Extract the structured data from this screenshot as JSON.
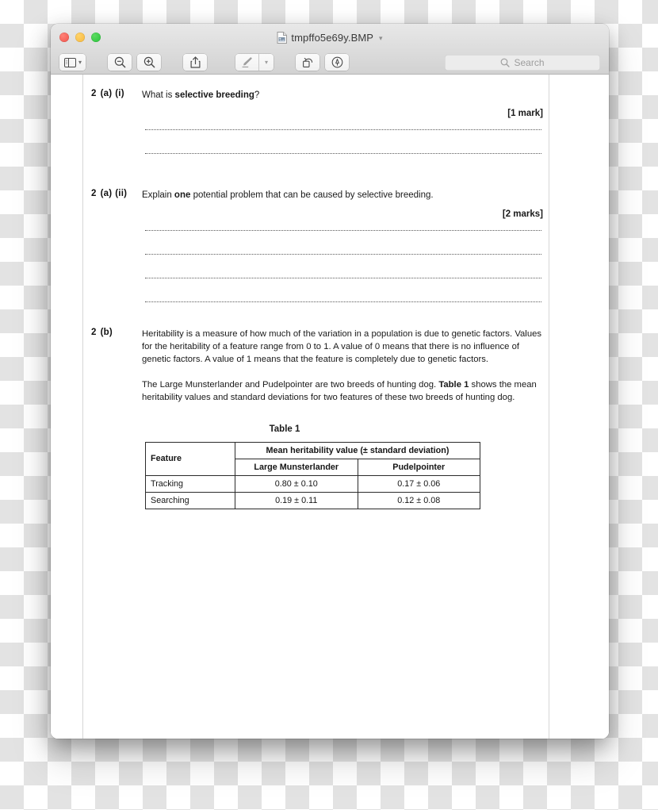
{
  "window": {
    "title": "tmpffo5e69y.BMP",
    "title_chevron": "chevron-down-icon",
    "traffic_lights": {
      "close": "close-button",
      "minimize": "minimize-button",
      "zoom": "zoom-button"
    }
  },
  "toolbar": {
    "sidebar_button_label": "sidebar-view",
    "sidebar_chevron": "⌄",
    "zoom_out_label": "zoom-out",
    "zoom_in_label": "zoom-in",
    "share_label": "share",
    "markup_label": "markup",
    "markup_chevron": "⌄",
    "rotate_label": "rotate-left",
    "annotate_label": "annotate",
    "search": {
      "placeholder": "Search",
      "value": ""
    }
  },
  "document": {
    "questions": [
      {
        "number": "2",
        "part": "(a)",
        "sub": "(i)",
        "text_before": "What is ",
        "text_bold": "selective breeding",
        "text_after": "?",
        "marks": "[1 mark]",
        "lines": 2
      },
      {
        "number": "2",
        "part": "(a)",
        "sub": "(ii)",
        "text_before": "Explain ",
        "text_bold": "one",
        "text_after": " potential problem that can be caused by selective breeding.",
        "marks": "[2 marks]",
        "lines": 4
      }
    ],
    "part_b": {
      "number": "2",
      "part": "(b)",
      "paragraph_1": "Heritability is a measure of how much of the variation in a population is due to genetic factors.  Values for the heritability of a feature range from 0 to 1.  A value of 0 means that there is no influence of genetic factors.  A value of 1 means that the feature is completely due to genetic factors.",
      "paragraph_2_before": "The Large Munsterlander and Pudelpointer are two breeds of hunting dog.  ",
      "paragraph_2_bold": "Table 1",
      "paragraph_2_after": " shows the mean heritability values and standard deviations for two features of these two breeds of hunting dog."
    },
    "table": {
      "caption": "Table 1",
      "header_feature": "Feature",
      "header_span": "Mean heritability value (± standard deviation)",
      "header_breeds": [
        "Large Munsterlander",
        "Pudelpointer"
      ],
      "rows": [
        {
          "feature": "Tracking",
          "large_munsterlander": "0.80 ± 0.10",
          "pudelpointer": "0.17 ± 0.06"
        },
        {
          "feature": "Searching",
          "large_munsterlander": "0.19 ± 0.11",
          "pudelpointer": "0.12 ± 0.08"
        }
      ]
    }
  },
  "colors": {
    "close": "#f0524a",
    "minimize": "#f6b73c",
    "zoom": "#28c33a",
    "titlebar": "#e0e0e0",
    "toolbar": "#d6d6d6",
    "page": "#ffffff",
    "text": "#1a1a1a"
  }
}
